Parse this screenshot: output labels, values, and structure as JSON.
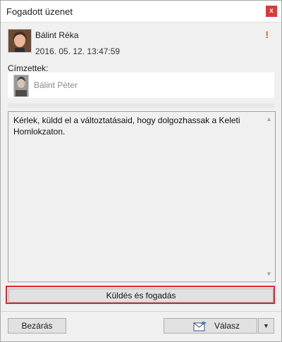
{
  "window": {
    "title": "Fogadott üzenet",
    "close_glyph": "x"
  },
  "sender": {
    "name": "Bálint Réka",
    "date": "2016. 05. 12. 13:47:59",
    "avatar_icon": "user-photo-icon",
    "priority_glyph": "!",
    "priority_color": "#e0620b"
  },
  "recipients": {
    "label": "Címzettek:",
    "items": [
      {
        "name": "Bálint Péter",
        "avatar_icon": "user-photo-icon"
      }
    ]
  },
  "message": {
    "body": "Kérlek, küldd el a változtatásaid, hogy dolgozhassak a Keleti Homlokzaton."
  },
  "buttons": {
    "send_receive": "Küldés és fogadás",
    "close": "Bezárás",
    "reply": "Válasz",
    "reply_dropdown_glyph": "▼"
  },
  "colors": {
    "highlight": "#e1262b",
    "close_button": "#d73a3a"
  }
}
